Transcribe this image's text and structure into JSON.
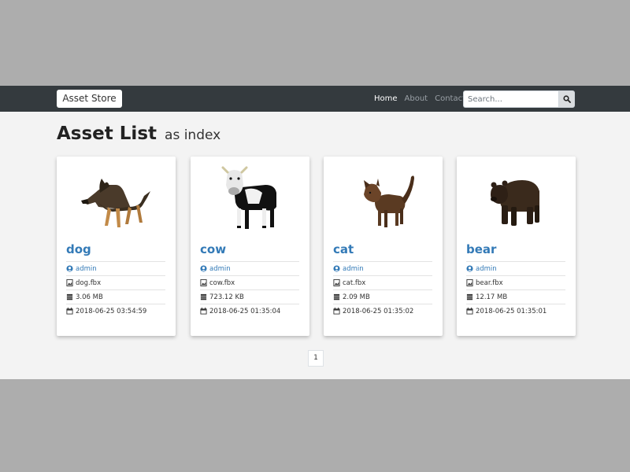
{
  "navbar": {
    "brand": "Asset Store",
    "links": [
      {
        "label": "Home",
        "active": true
      },
      {
        "label": "About",
        "active": false
      },
      {
        "label": "Contact",
        "active": false
      }
    ],
    "search": {
      "placeholder": "Search...",
      "value": ""
    },
    "colors": {
      "background": "#343a3e",
      "active_link": "#ffffff",
      "inactive_link": "#9aa0a6"
    }
  },
  "page": {
    "title": "Asset List",
    "subtitle": "as index"
  },
  "assets": [
    {
      "name": "dog",
      "image": "dog-icon",
      "author": "admin",
      "file": "dog.fbx",
      "size": "3.06 MB",
      "date": "2018-06-25 03:54:59"
    },
    {
      "name": "cow",
      "image": "cow-icon",
      "author": "admin",
      "file": "cow.fbx",
      "size": "723.12 KB",
      "date": "2018-06-25 01:35:04"
    },
    {
      "name": "cat",
      "image": "cat-icon",
      "author": "admin",
      "file": "cat.fbx",
      "size": "2.09 MB",
      "date": "2018-06-25 01:35:02"
    },
    {
      "name": "bear",
      "image": "bear-icon",
      "author": "admin",
      "file": "bear.fbx",
      "size": "12.17 MB",
      "date": "2018-06-25 01:35:01"
    }
  ],
  "pagination": {
    "current": "1"
  },
  "colors": {
    "link": "#337ab7",
    "content_bg": "#f3f3f3",
    "outer_bg": "#adadad"
  }
}
